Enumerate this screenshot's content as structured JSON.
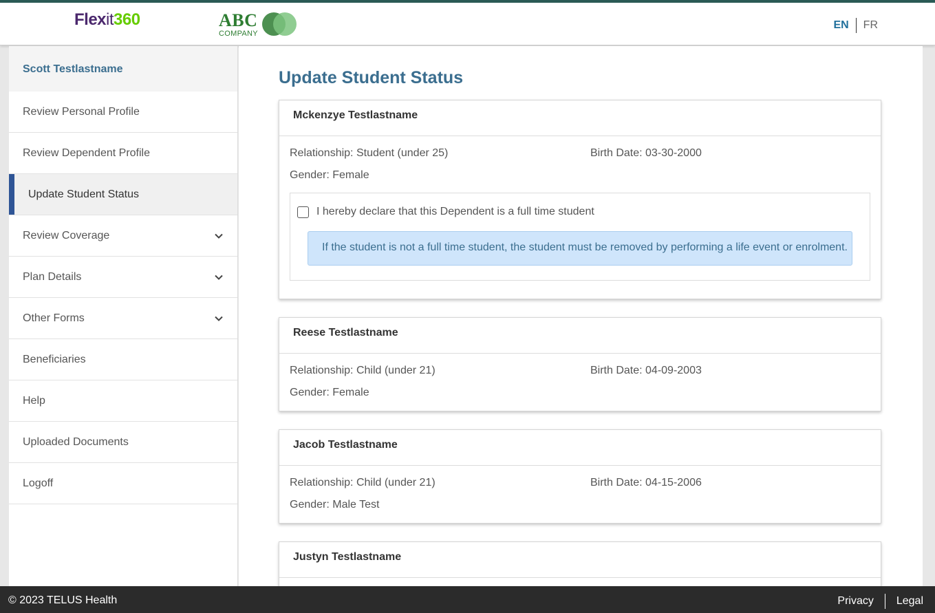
{
  "header": {
    "brand_part1": "Flex",
    "brand_part2": "it",
    "brand_part3": "360",
    "company_name": "ABC",
    "company_sub": "COMPANY",
    "lang_en": "EN",
    "lang_fr": "FR"
  },
  "colors": {
    "accent_blue": "#3b6e8f",
    "active_bar": "#2f5596",
    "brand_purple": "#4b286d",
    "brand_green": "#66cc00",
    "alert_bg": "#cfe5fb"
  },
  "sidebar": {
    "user_name": "Scott Testlastname",
    "items": [
      {
        "label": "Review Personal Profile",
        "has_chevron": false,
        "active": false
      },
      {
        "label": "Review Dependent Profile",
        "has_chevron": false,
        "active": false
      },
      {
        "label": "Update Student Status",
        "has_chevron": false,
        "active": true
      },
      {
        "label": "Review Coverage",
        "has_chevron": true,
        "active": false
      },
      {
        "label": "Plan Details",
        "has_chevron": true,
        "active": false
      },
      {
        "label": "Other Forms",
        "has_chevron": true,
        "active": false
      },
      {
        "label": "Beneficiaries",
        "has_chevron": false,
        "active": false
      },
      {
        "label": "Help",
        "has_chevron": false,
        "active": false
      },
      {
        "label": "Uploaded Documents",
        "has_chevron": false,
        "active": false
      },
      {
        "label": "Logoff",
        "has_chevron": false,
        "active": false
      }
    ],
    "chevron_icon": "chevron-down-icon"
  },
  "main": {
    "title": "Update Student Status",
    "dependents": [
      {
        "name": "Mckenzye Testlastname",
        "relationship": "Relationship: Student (under 25)",
        "birth_date": "Birth Date: 03-30-2000",
        "gender": "Gender: Female",
        "declaration": "I hereby declare that this Dependent is a full time student",
        "declaration_checked": false,
        "alert": "If the student is not a full time student, the student must be removed by performing a life event or enrolment."
      },
      {
        "name": "Reese Testlastname",
        "relationship": "Relationship: Child (under 21)",
        "birth_date": "Birth Date: 04-09-2003",
        "gender": "Gender: Female"
      },
      {
        "name": "Jacob Testlastname",
        "relationship": "Relationship: Child (under 21)",
        "birth_date": "Birth Date: 04-15-2006",
        "gender": "Gender: Male Test"
      },
      {
        "name": "Justyn Testlastname"
      }
    ]
  },
  "footer": {
    "copyright": "© 2023 TELUS Health",
    "privacy": "Privacy",
    "legal": "Legal"
  }
}
